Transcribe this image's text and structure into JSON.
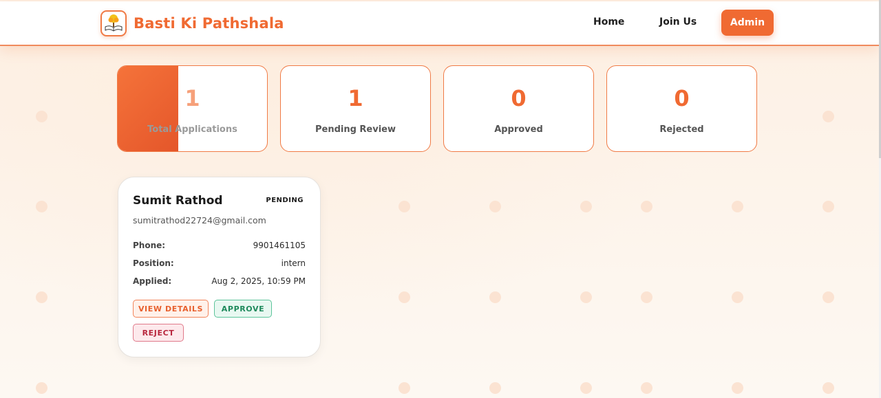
{
  "header": {
    "brand_name": "Basti Ki Pathshala",
    "logo_icon": "book-tree-icon",
    "nav": {
      "home": "Home",
      "join_us": "Join Us",
      "admin": "Admin"
    }
  },
  "colors": {
    "accent": "#f06a32",
    "background": "#fdf6ee",
    "approve": "#1e8a5c",
    "reject": "#b8273e"
  },
  "stats": [
    {
      "value": "1",
      "label": "Total Applications"
    },
    {
      "value": "1",
      "label": "Pending Review"
    },
    {
      "value": "0",
      "label": "Approved"
    },
    {
      "value": "0",
      "label": "Rejected"
    }
  ],
  "applications": [
    {
      "name": "Sumit Rathod",
      "status": "PENDING",
      "email": "sumitrathod22724@gmail.com",
      "phone_label": "Phone:",
      "phone": "9901461105",
      "position_label": "Position:",
      "position": "intern",
      "applied_label": "Applied:",
      "applied": "Aug 2, 2025, 10:59 PM",
      "actions": {
        "view": "VIEW DETAILS",
        "approve": "APPROVE",
        "reject": "REJECT"
      }
    }
  ]
}
